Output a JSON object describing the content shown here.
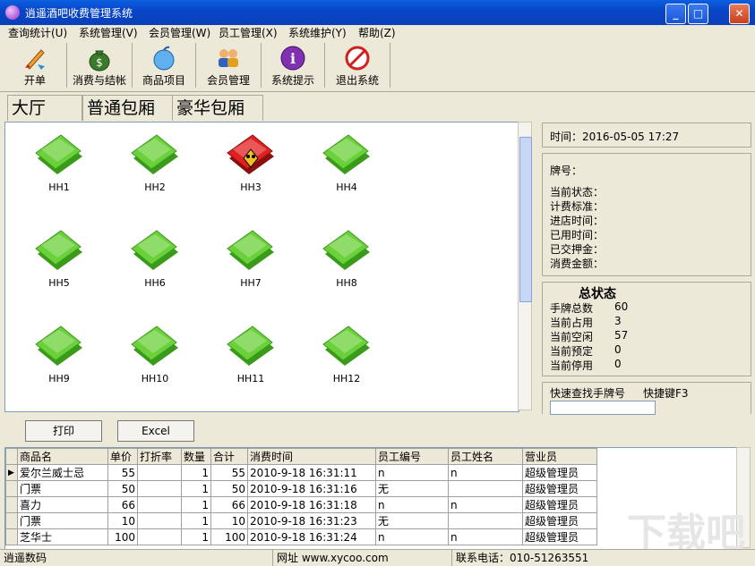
{
  "window": {
    "title": "逍遥酒吧收费管理系统"
  },
  "menu": [
    "查询统计(U)",
    "系统管理(V)",
    "会员管理(W)",
    "员工管理(X)",
    "系统维护(Y)",
    "帮助(Z)"
  ],
  "toolbar": [
    {
      "label": "开单",
      "icon": "brush-icon"
    },
    {
      "label": "消费与结帐",
      "icon": "money-bag-icon"
    },
    {
      "label": "商品项目",
      "icon": "apple-icon"
    },
    {
      "label": "会员管理",
      "icon": "members-icon"
    },
    {
      "label": "系统提示",
      "icon": "info-icon"
    },
    {
      "label": "退出系统",
      "icon": "exit-icon"
    }
  ],
  "tabs": [
    "大厅",
    "普通包厢",
    "豪华包厢"
  ],
  "active_tab": "豪华包厢",
  "rooms": [
    {
      "name": "HH1",
      "status": "free"
    },
    {
      "name": "HH2",
      "status": "free"
    },
    {
      "name": "HH3",
      "status": "occupied"
    },
    {
      "name": "HH4",
      "status": "free"
    },
    {
      "name": "HH5",
      "status": "free"
    },
    {
      "name": "HH6",
      "status": "free"
    },
    {
      "name": "HH7",
      "status": "free"
    },
    {
      "name": "HH8",
      "status": "free"
    },
    {
      "name": "HH9",
      "status": "free"
    },
    {
      "name": "HH10",
      "status": "free"
    },
    {
      "name": "HH11",
      "status": "free"
    },
    {
      "name": "HH12",
      "status": "free"
    }
  ],
  "time_panel": {
    "label": "时间：",
    "value": "2016-05-05 17:27"
  },
  "card_panel": {
    "plate_label": "牌号：",
    "fields": [
      "当前状态：",
      "计费标准：",
      "进店时间：",
      "已用时间：",
      "已交押金：",
      "消费金额："
    ]
  },
  "summary": {
    "title": "总状态",
    "rows": [
      {
        "label": "手牌总数",
        "value": "60"
      },
      {
        "label": "当前占用",
        "value": "3"
      },
      {
        "label": "当前空闲",
        "value": "57"
      },
      {
        "label": "当前预定",
        "value": "0"
      },
      {
        "label": "当前停用",
        "value": "0"
      }
    ]
  },
  "quick_search": {
    "label": "快速查找手牌号",
    "shortcut": "快捷键F3",
    "value": ""
  },
  "buttons": {
    "print": "打印",
    "excel": "Excel"
  },
  "grid": {
    "columns": [
      "商品名",
      "单价",
      "打折率",
      "数量",
      "合计",
      "消费时间",
      "员工编号",
      "员工姓名",
      "营业员"
    ],
    "rows": [
      [
        "爱尔兰威士忌",
        "55",
        "",
        "1",
        "55",
        "2010-9-18 16:31:11",
        "n",
        "n",
        "超级管理员"
      ],
      [
        "门票",
        "50",
        "",
        "1",
        "50",
        "2010-9-18 16:31:16",
        "无",
        "",
        "超级管理员"
      ],
      [
        "喜力",
        "66",
        "",
        "1",
        "66",
        "2010-9-18 16:31:18",
        "n",
        "n",
        "超级管理员"
      ],
      [
        "门票",
        "10",
        "",
        "1",
        "10",
        "2010-9-18 16:31:23",
        "无",
        "",
        "超级管理员"
      ],
      [
        "芝华士",
        "100",
        "",
        "1",
        "100",
        "2010-9-18 16:31:24",
        "n",
        "n",
        "超级管理员"
      ]
    ]
  },
  "statusbar": {
    "left": "逍遥数码",
    "site": "网址 www.xycoo.com",
    "phone": "联系电话：010-51263551"
  },
  "colors": {
    "free": "#6ad13a",
    "occupied": "#e02020",
    "titlebar": "#0846c8"
  }
}
